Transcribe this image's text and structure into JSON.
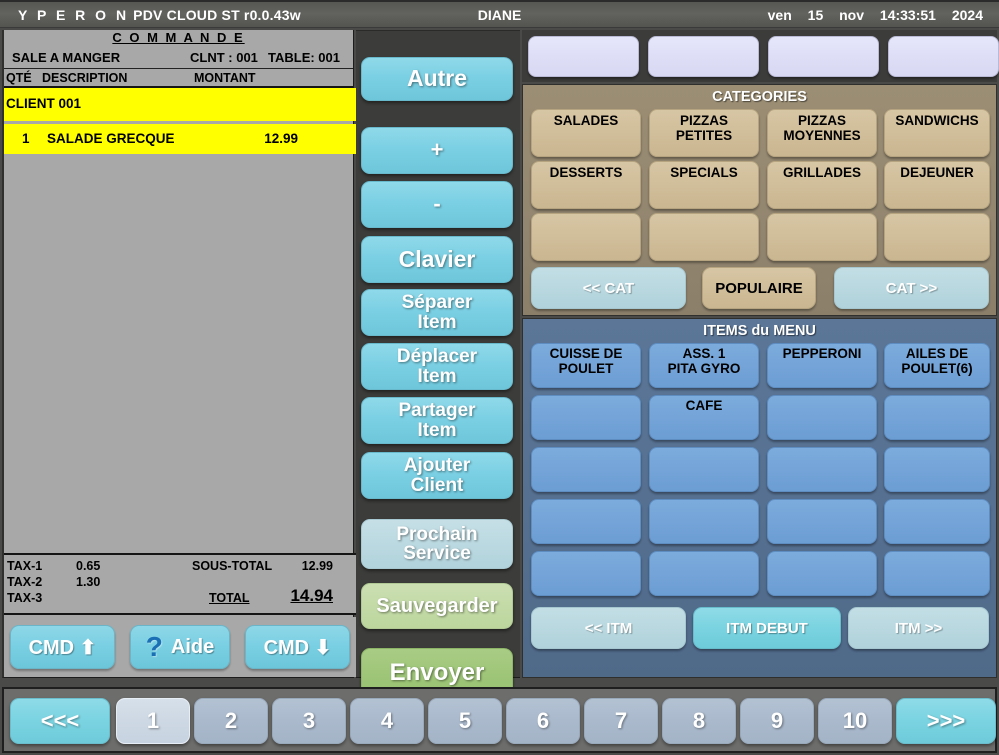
{
  "topbar": {
    "brand": "Y P E R O N",
    "app": "PDV",
    "mode": "CLOUD",
    "station": "ST",
    "version": "r0.0.43w",
    "user": "DIANE",
    "day": "ven",
    "date": "15",
    "month": "nov",
    "time": "14:33:51",
    "year": "2024"
  },
  "order": {
    "title": "C O M M A N D E",
    "room": "SALE A MANGER",
    "client_label": "CLNT : 001",
    "table_label": "TABLE: 001",
    "columns": {
      "qty": "QTÉ",
      "description": "DESCRIPTION",
      "amount": "MONTANT"
    },
    "client_row": "CLIENT 001",
    "lines": [
      {
        "qty": "1",
        "description": "SALADE GRECQUE",
        "amount": "12.99"
      }
    ],
    "totals": {
      "tax1_label": "TAX-1",
      "tax1_value": "0.65",
      "tax2_label": "TAX-2",
      "tax2_value": "1.30",
      "tax3_label": "TAX-3",
      "tax3_value": "",
      "subtotal_label": "SOUS-TOTAL",
      "subtotal_value": "12.99",
      "total_label": "TOTAL",
      "total_value": "14.94"
    },
    "footer_buttons": {
      "up": "CMD ⬆",
      "help": "Aide",
      "down": "CMD ⬇"
    }
  },
  "actions": [
    {
      "label": "Autre",
      "style": "blue"
    },
    {
      "label": "+",
      "style": "blue"
    },
    {
      "label": "-",
      "style": "blue"
    },
    {
      "label": "Clavier",
      "style": "blue"
    },
    {
      "label": "Séparer\nItem",
      "style": "blue"
    },
    {
      "label": "Déplacer\nItem",
      "style": "blue"
    },
    {
      "label": "Partager\nItem",
      "style": "blue"
    },
    {
      "label": "Ajouter\nClient",
      "style": "blue"
    },
    {
      "label": "Prochain\nService",
      "style": "palesky"
    },
    {
      "label": "Sauvegarder",
      "style": "palegreen"
    },
    {
      "label": "Envoyer",
      "style": "green"
    }
  ],
  "quick_slots": [
    "",
    "",
    "",
    ""
  ],
  "categories": {
    "title": "CATEGORIES",
    "buttons": [
      "SALADES",
      "PIZZAS\nPETITES",
      "PIZZAS\nMOYENNES",
      "SANDWICHS",
      "DESSERTS",
      "SPECIALS",
      "GRILLADES",
      "DEJEUNER",
      "",
      "",
      "",
      ""
    ],
    "nav": {
      "prev": "<<  CAT",
      "current": "POPULAIRE",
      "next": "CAT  >>"
    }
  },
  "menu_items": {
    "title": "ITEMS du MENU",
    "buttons": [
      "CUISSE DE\nPOULET",
      "ASS. 1\nPITA GYRO",
      "PEPPERONI",
      "AILES DE\nPOULET(6)",
      "",
      "CAFE",
      "",
      "",
      "",
      "",
      "",
      "",
      "",
      "",
      "",
      "",
      "",
      "",
      "",
      ""
    ],
    "nav": {
      "prev": "<<  ITM",
      "current": "ITM DEBUT",
      "next": "ITM  >>"
    }
  },
  "pager": {
    "prev": "<<<",
    "pages": [
      "1",
      "2",
      "3",
      "4",
      "5",
      "6",
      "7",
      "8",
      "9",
      "10"
    ],
    "active_index": 0,
    "next": ">>>"
  },
  "colors": {
    "accent_blue": "#7bd0e3",
    "accent_green": "#9fc679",
    "category_panel": "#938670",
    "items_panel": "#556f90",
    "highlight_row": "#ffff00"
  }
}
